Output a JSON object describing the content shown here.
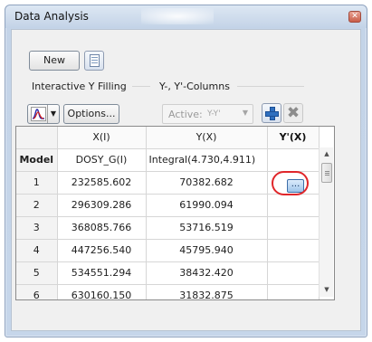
{
  "window": {
    "title": "Data Analysis",
    "close_symbol": "✕"
  },
  "toolbar": {
    "new_label": "New"
  },
  "interactive_y_filling": {
    "group_label": "Interactive Y Filling",
    "dropdown_arrow": "▼",
    "options_label": "Options..."
  },
  "y_columns": {
    "group_label": "Y-, Y'-Columns",
    "active_label": "Active:",
    "active_value": "Y-Y'",
    "active_arrow": "▼",
    "remove_symbol": "✖"
  },
  "table": {
    "headers": [
      "",
      "X(I)",
      "Y(X)",
      "Y'(X)"
    ],
    "model_row": {
      "label": "Model",
      "x": "DOSY_G(I)",
      "y": "Integral(4.730,4.911)",
      "yprime_button": "..."
    },
    "rows": [
      {
        "index": "1",
        "x": "232585.602",
        "y": "70382.682",
        "yprime": ""
      },
      {
        "index": "2",
        "x": "296309.286",
        "y": "61990.094",
        "yprime": ""
      },
      {
        "index": "3",
        "x": "368085.766",
        "y": "53716.519",
        "yprime": ""
      },
      {
        "index": "4",
        "x": "447256.540",
        "y": "45795.940",
        "yprime": ""
      },
      {
        "index": "5",
        "x": "534551.294",
        "y": "38432.420",
        "yprime": ""
      },
      {
        "index": "6",
        "x": "630160.150",
        "y": "31832.875",
        "yprime": ""
      }
    ]
  },
  "scrollbar": {
    "up_symbol": "▲",
    "down_symbol": "▼"
  },
  "colors": {
    "highlight": "#e0262a",
    "title_bar": "#c4d4e8",
    "panel": "#f0f0f0"
  }
}
